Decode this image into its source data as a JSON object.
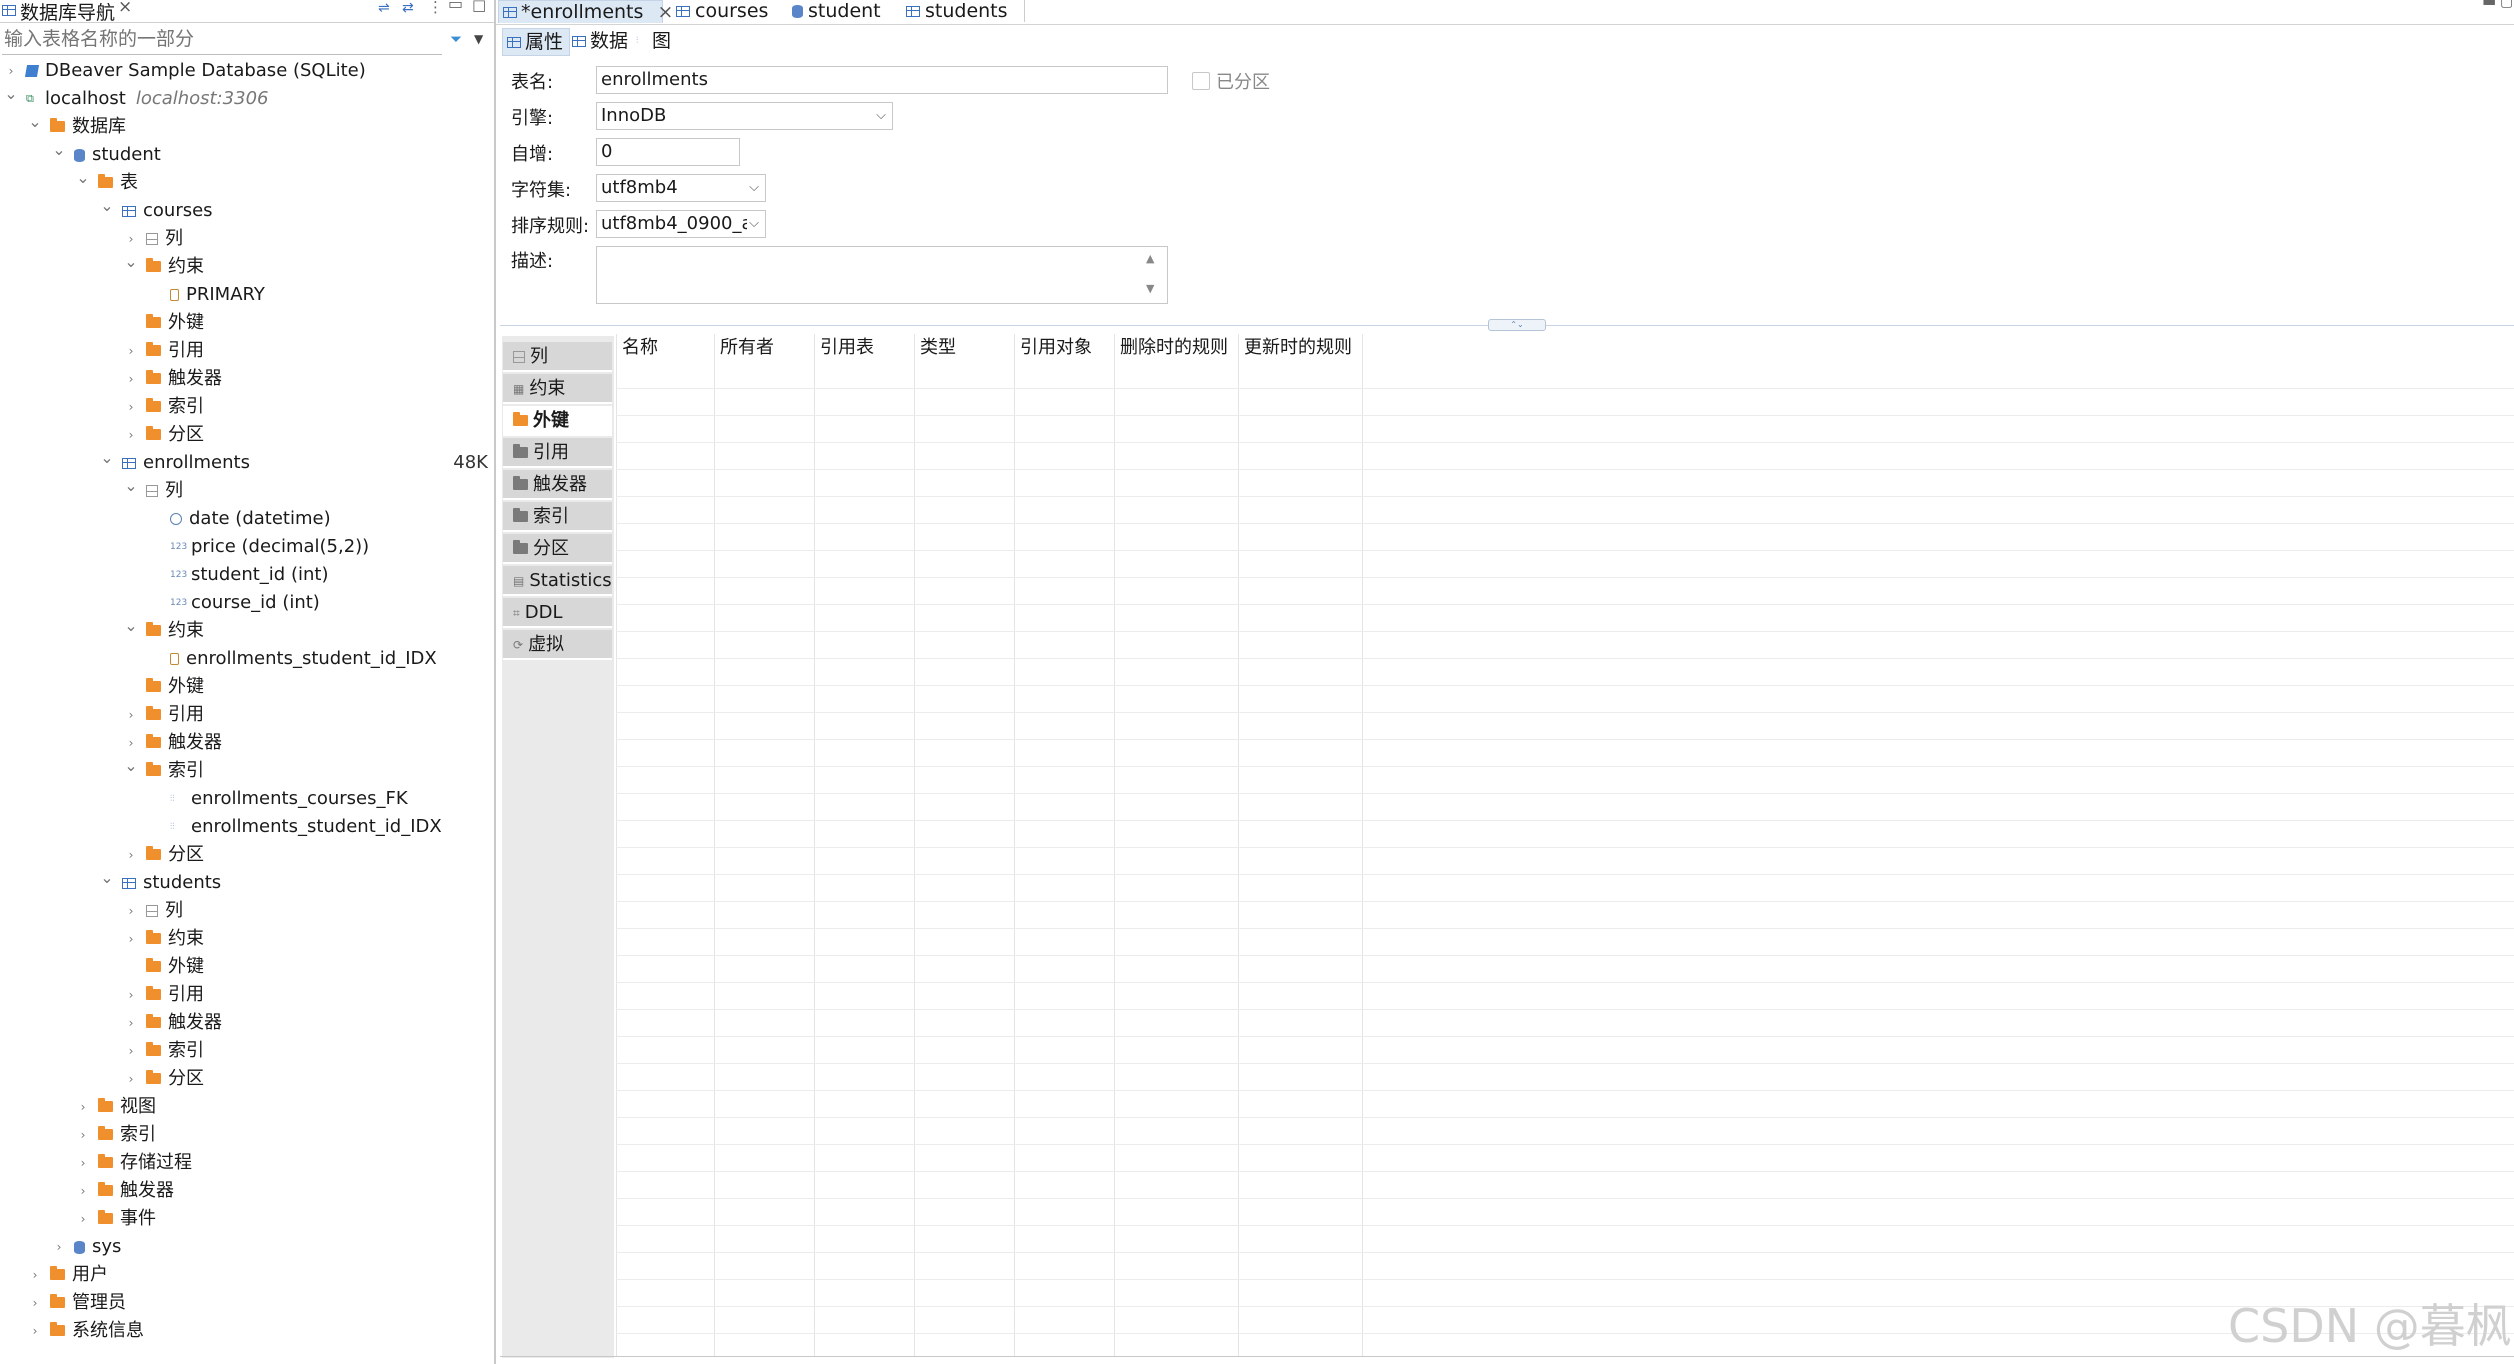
{
  "navigator": {
    "title": "数据库导航",
    "search_placeholder": "输入表格名称的一部分",
    "tree": [
      {
        "label": "DBeaver Sample Database (SQLite)",
        "depth": 0,
        "icon": "sqlite-db-icon",
        "chevron": ">"
      },
      {
        "label": "localhost",
        "secondary": "localhost:3306",
        "depth": 0,
        "icon": "host-icon",
        "chevron": "v"
      },
      {
        "label": "数据库",
        "depth": 1,
        "icon": "folder-icon",
        "chevron": "v"
      },
      {
        "label": "student",
        "depth": 2,
        "icon": "database-icon",
        "chevron": "v"
      },
      {
        "label": "表",
        "depth": 3,
        "icon": "folder-icon",
        "chevron": "v"
      },
      {
        "label": "courses",
        "depth": 4,
        "icon": "table-icon",
        "chevron": "v"
      },
      {
        "label": "列",
        "depth": 5,
        "icon": "columns-icon",
        "chevron": ">"
      },
      {
        "label": "约束",
        "depth": 5,
        "icon": "folder-icon",
        "chevron": "v"
      },
      {
        "label": "PRIMARY",
        "depth": 6,
        "icon": "key-icon",
        "chevron": ""
      },
      {
        "label": "外键",
        "depth": 5,
        "icon": "folder-icon",
        "chevron": ""
      },
      {
        "label": "引用",
        "depth": 5,
        "icon": "folder-icon",
        "chevron": ">"
      },
      {
        "label": "触发器",
        "depth": 5,
        "icon": "folder-icon",
        "chevron": ">"
      },
      {
        "label": "索引",
        "depth": 5,
        "icon": "folder-icon",
        "chevron": ">"
      },
      {
        "label": "分区",
        "depth": 5,
        "icon": "folder-icon",
        "chevron": ">"
      },
      {
        "label": "enrollments",
        "badge": "48K",
        "depth": 4,
        "icon": "table-icon",
        "chevron": "v"
      },
      {
        "label": "列",
        "depth": 5,
        "icon": "columns-icon",
        "chevron": "v"
      },
      {
        "label": "date (datetime)",
        "depth": 6,
        "icon": "clock-icon",
        "chevron": ""
      },
      {
        "label": "price (decimal(5,2))",
        "depth": 6,
        "icon": "number-icon",
        "chevron": ""
      },
      {
        "label": "student_id (int)",
        "depth": 6,
        "icon": "number-icon",
        "chevron": ""
      },
      {
        "label": "course_id (int)",
        "depth": 6,
        "icon": "number-icon",
        "chevron": ""
      },
      {
        "label": "约束",
        "depth": 5,
        "icon": "folder-icon",
        "chevron": "v"
      },
      {
        "label": "enrollments_student_id_IDX",
        "depth": 6,
        "icon": "key-icon",
        "chevron": ""
      },
      {
        "label": "外键",
        "depth": 5,
        "icon": "folder-icon",
        "chevron": ""
      },
      {
        "label": "引用",
        "depth": 5,
        "icon": "folder-icon",
        "chevron": ">"
      },
      {
        "label": "触发器",
        "depth": 5,
        "icon": "folder-icon",
        "chevron": ">"
      },
      {
        "label": "索引",
        "depth": 5,
        "icon": "folder-icon",
        "chevron": "v"
      },
      {
        "label": "enrollments_courses_FK",
        "depth": 6,
        "icon": "index-icon",
        "chevron": ""
      },
      {
        "label": "enrollments_student_id_IDX",
        "depth": 6,
        "icon": "index-icon",
        "chevron": ""
      },
      {
        "label": "分区",
        "depth": 5,
        "icon": "folder-icon",
        "chevron": ">"
      },
      {
        "label": "students",
        "depth": 4,
        "icon": "table-icon",
        "chevron": "v"
      },
      {
        "label": "列",
        "depth": 5,
        "icon": "columns-icon",
        "chevron": ">"
      },
      {
        "label": "约束",
        "depth": 5,
        "icon": "folder-icon",
        "chevron": ">"
      },
      {
        "label": "外键",
        "depth": 5,
        "icon": "folder-icon",
        "chevron": ""
      },
      {
        "label": "引用",
        "depth": 5,
        "icon": "folder-icon",
        "chevron": ">"
      },
      {
        "label": "触发器",
        "depth": 5,
        "icon": "folder-icon",
        "chevron": ">"
      },
      {
        "label": "索引",
        "depth": 5,
        "icon": "folder-icon",
        "chevron": ">"
      },
      {
        "label": "分区",
        "depth": 5,
        "icon": "folder-icon",
        "chevron": ">"
      },
      {
        "label": "视图",
        "depth": 3,
        "icon": "folder-icon",
        "chevron": ">"
      },
      {
        "label": "索引",
        "depth": 3,
        "icon": "folder-icon",
        "chevron": ">"
      },
      {
        "label": "存储过程",
        "depth": 3,
        "icon": "folder-icon",
        "chevron": ">"
      },
      {
        "label": "触发器",
        "depth": 3,
        "icon": "folder-icon",
        "chevron": ">"
      },
      {
        "label": "事件",
        "depth": 3,
        "icon": "folder-icon",
        "chevron": ">"
      },
      {
        "label": "sys",
        "depth": 2,
        "icon": "database-icon",
        "chevron": ">"
      },
      {
        "label": "用户",
        "depth": 1,
        "icon": "folder-icon",
        "chevron": ">"
      },
      {
        "label": "管理员",
        "depth": 1,
        "icon": "folder-icon",
        "chevron": ">"
      },
      {
        "label": "系统信息",
        "depth": 1,
        "icon": "folder-icon",
        "chevron": ">"
      }
    ]
  },
  "editor_tabs": [
    {
      "label": "*enrollments",
      "close": "×",
      "active": true
    },
    {
      "label": "courses",
      "active": false
    },
    {
      "label": "student",
      "active": false
    },
    {
      "label": "students",
      "active": false
    }
  ],
  "sub_tabs": [
    {
      "label": "属性",
      "active": true
    },
    {
      "label": "数据",
      "active": false
    },
    {
      "label": "图",
      "active": false
    }
  ],
  "properties": {
    "table_name_label": "表名:",
    "table_name_value": "enrollments",
    "partitioned_label": "已分区",
    "engine_label": "引擎:",
    "engine_value": "InnoDB",
    "auto_inc_label": "自增:",
    "auto_inc_value": "0",
    "charset_label": "字符集:",
    "charset_value": "utf8mb4",
    "collation_label": "排序规则:",
    "collation_value": "utf8mb4_0900_a",
    "description_label": "描述:",
    "description_value": ""
  },
  "side_tabs": [
    {
      "label": "列",
      "icon": "columns-icon",
      "active": false
    },
    {
      "label": "约束",
      "icon": "constraint-icon",
      "active": false
    },
    {
      "label": "外键",
      "icon": "folder-icon",
      "active": true
    },
    {
      "label": "引用",
      "icon": "folder-icon",
      "active": false
    },
    {
      "label": "触发器",
      "icon": "folder-icon",
      "active": false
    },
    {
      "label": "索引",
      "icon": "folder-icon",
      "active": false
    },
    {
      "label": "分区",
      "icon": "folder-icon",
      "active": false
    },
    {
      "label": "Statistics",
      "icon": "statistics-icon",
      "active": false
    },
    {
      "label": "DDL",
      "icon": "ddl-icon",
      "active": false
    },
    {
      "label": "虚拟",
      "icon": "virtual-icon",
      "active": false
    }
  ],
  "fk_table": {
    "columns": [
      "名称",
      "所有者",
      "引用表",
      "类型",
      "引用对象",
      "删除时的规则",
      "更新时的规则"
    ]
  },
  "watermark": "CSDN @暮枫"
}
